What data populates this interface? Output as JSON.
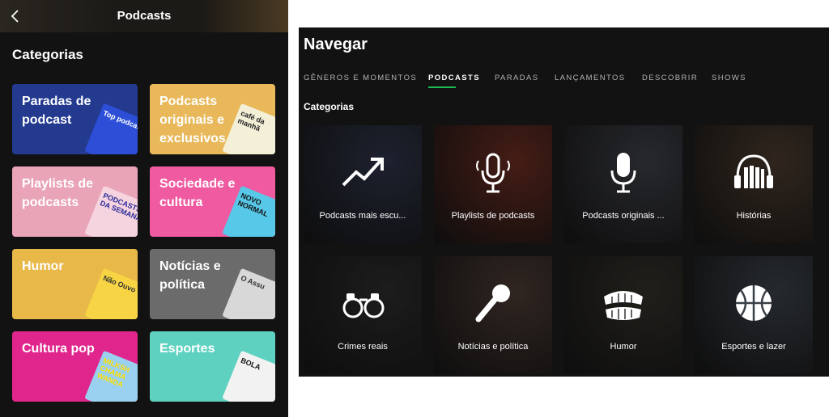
{
  "mobile": {
    "title": "Podcasts",
    "section": "Categorias",
    "cards": [
      {
        "label": "Paradas de podcast",
        "bg": "#233a8f",
        "art_text": "Top podcasts",
        "art_bg": "#2d4fd8",
        "art_fg": "#ffffff"
      },
      {
        "label": "Podcasts originais e exclusivos",
        "bg": "#e8b85a",
        "art_text": "café da manhã",
        "art_bg": "#f4f0d8",
        "art_fg": "#222222"
      },
      {
        "label": "Playlists de podcasts",
        "bg": "#e9a4b8",
        "art_text": "PODCASTS DA SEMANA",
        "art_bg": "#f5d4e0",
        "art_fg": "#2a2a9a"
      },
      {
        "label": "Sociedade e cultura",
        "bg": "#ef5aa0",
        "art_text": "NOVO NORMAL",
        "art_bg": "#58c8e8",
        "art_fg": "#111111"
      },
      {
        "label": "Humor",
        "bg": "#e8b848",
        "art_text": "Não Ouvo",
        "art_bg": "#f6d444",
        "art_fg": "#333333"
      },
      {
        "label": "Notícias e política",
        "bg": "#6b6b6b",
        "art_text": "O Assu",
        "art_bg": "#d8d8d8",
        "art_fg": "#333333"
      },
      {
        "label": "Cultura pop",
        "bg": "#e0268c",
        "art_text": "MILKSH CHAMA WANDA",
        "art_bg": "#9ad0f0",
        "art_fg": "#ffe000"
      },
      {
        "label": "Esportes",
        "bg": "#5fd1c0",
        "art_text": "BOLA",
        "art_bg": "#f2f2f2",
        "art_fg": "#111111"
      }
    ]
  },
  "desktop": {
    "title": "Navegar",
    "tabs": [
      "GÊNEROS E MOMENTOS",
      "PODCASTS",
      "PARADAS",
      "LANÇAMENTOS",
      "DESCOBRIR",
      "SHOWS"
    ],
    "active_tab": "PODCASTS",
    "section": "Categorias",
    "tiles": [
      {
        "label": "Podcasts mais escu...",
        "icon": "trending-up-icon",
        "bg": "#2e3448"
      },
      {
        "label": "Playlists de podcasts",
        "icon": "microphone-icon",
        "bg": "#6b2c22"
      },
      {
        "label": "Podcasts originais ...",
        "icon": "studio-microphone-icon",
        "bg": "#3d3f46"
      },
      {
        "label": "Histórias",
        "icon": "headphones-books-icon",
        "bg": "#4a3a2e"
      },
      {
        "label": "Crimes reais",
        "icon": "handcuffs-icon",
        "bg": "#2c2c2c"
      },
      {
        "label": "Notícias e política",
        "icon": "handheld-microphone-icon",
        "bg": "#4a3a34"
      },
      {
        "label": "Humor",
        "icon": "teeth-icon",
        "bg": "#33302a"
      },
      {
        "label": "Esportes e lazer",
        "icon": "basketball-icon",
        "bg": "#3a4048"
      }
    ]
  },
  "colors": {
    "accent": "#1db954",
    "background": "#121212"
  }
}
